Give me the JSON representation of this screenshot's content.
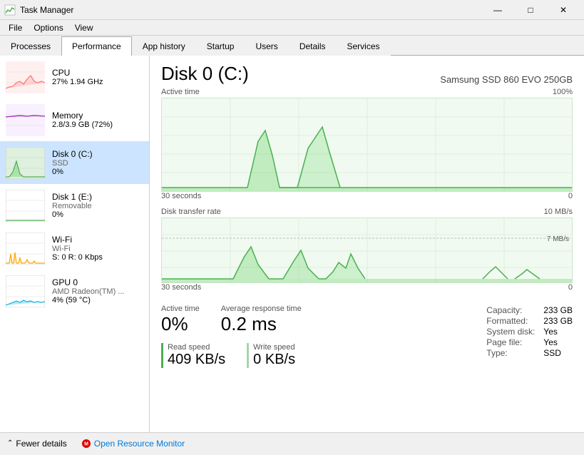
{
  "titlebar": {
    "title": "Task Manager",
    "icon": "📊",
    "min_btn": "—",
    "max_btn": "□",
    "close_btn": "✕"
  },
  "menubar": {
    "items": [
      "File",
      "Options",
      "View"
    ]
  },
  "tabs": [
    {
      "label": "Processes",
      "active": false
    },
    {
      "label": "Performance",
      "active": true
    },
    {
      "label": "App history",
      "active": false
    },
    {
      "label": "Startup",
      "active": false
    },
    {
      "label": "Users",
      "active": false
    },
    {
      "label": "Details",
      "active": false
    },
    {
      "label": "Services",
      "active": false
    }
  ],
  "sidebar": {
    "items": [
      {
        "name": "CPU",
        "sub": "27% 1.94 GHz",
        "type": "cpu",
        "active": false
      },
      {
        "name": "Memory",
        "sub": "2.8/3.9 GB (72%)",
        "type": "memory",
        "active": false
      },
      {
        "name": "Disk 0 (C:)",
        "sub": "SSD",
        "val": "0%",
        "type": "disk0",
        "active": true
      },
      {
        "name": "Disk 1 (E:)",
        "sub": "Removable",
        "val": "0%",
        "type": "disk1",
        "active": false
      },
      {
        "name": "Wi-Fi",
        "sub": "Wi-Fi",
        "val": "S: 0 R: 0 Kbps",
        "type": "wifi",
        "active": false
      },
      {
        "name": "GPU 0",
        "sub": "AMD Radeon(TM) ...",
        "val": "4% (59 °C)",
        "type": "gpu",
        "active": false
      }
    ]
  },
  "content": {
    "title": "Disk 0 (C:)",
    "subtitle": "Samsung SSD 860 EVO 250GB",
    "chart1": {
      "label_left": "Active time",
      "label_right": "100%",
      "label_bottom_left": "30 seconds",
      "label_bottom_right": "0"
    },
    "chart2": {
      "label_left": "Disk transfer rate",
      "label_right": "10 MB/s",
      "label_right2": "7 MB/s",
      "label_bottom_left": "30 seconds",
      "label_bottom_right": "0"
    },
    "stats": {
      "active_time_label": "Active time",
      "active_time_value": "0%",
      "avg_response_label": "Average response time",
      "avg_response_value": "0.2 ms"
    },
    "speeds": {
      "read_label": "Read speed",
      "read_value": "409 KB/s",
      "write_label": "Write speed",
      "write_value": "0 KB/s"
    },
    "info": {
      "capacity_label": "Capacity:",
      "capacity_value": "233 GB",
      "formatted_label": "Formatted:",
      "formatted_value": "233 GB",
      "system_disk_label": "System disk:",
      "system_disk_value": "Yes",
      "page_file_label": "Page file:",
      "page_file_value": "Yes",
      "type_label": "Type:",
      "type_value": "SSD"
    }
  },
  "bottombar": {
    "fewer_details": "Fewer details",
    "open_resource": "Open Resource Monitor"
  }
}
